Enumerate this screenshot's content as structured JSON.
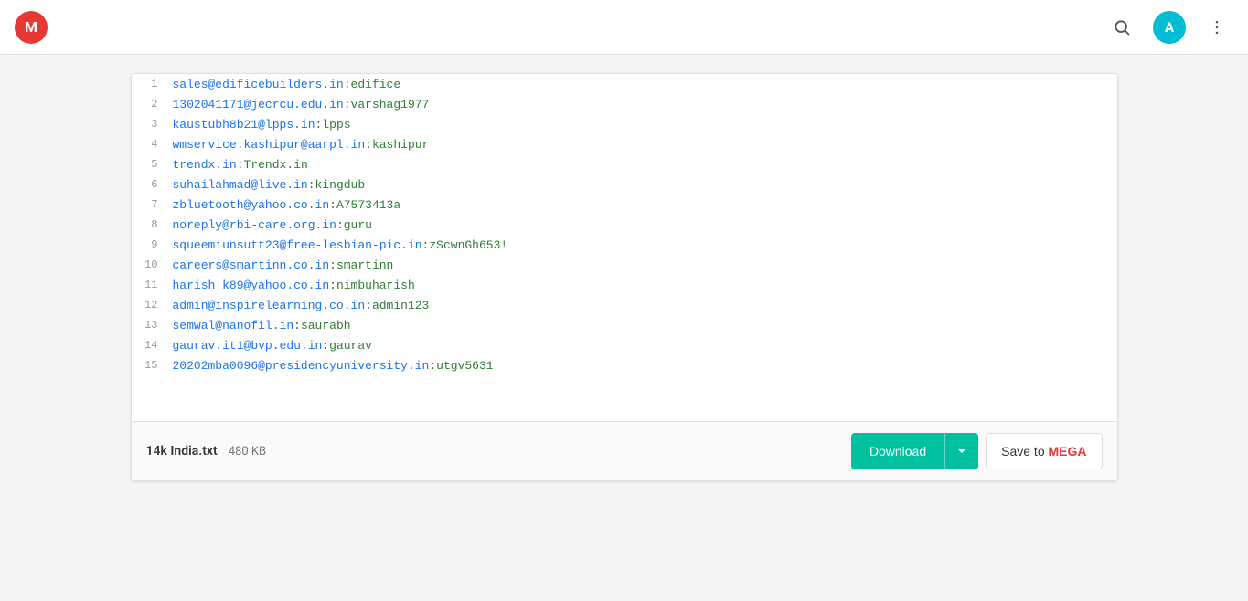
{
  "header": {
    "logo_letter": "M",
    "search_label": "search",
    "avatar_letter": "A",
    "more_label": "more options"
  },
  "file": {
    "name": "14k India.txt",
    "size": "480 KB",
    "download_label": "Download",
    "save_label": "Save to MEGA",
    "save_prefix": "Save to ",
    "save_brand": "MEGA"
  },
  "lines": [
    {
      "num": "1",
      "text": "sales@edificebuilders.in:edifice"
    },
    {
      "num": "2",
      "text": "1302041171@jecrcu.edu.in:varshag1977"
    },
    {
      "num": "3",
      "text": "kaustubh8b21@lpps.in:lpps"
    },
    {
      "num": "4",
      "text": "wmservice.kashipur@aarpl.in:kashipur"
    },
    {
      "num": "5",
      "text": "trendx.in:Trendx.in"
    },
    {
      "num": "6",
      "text": "suhailahmad@live.in:kingdub"
    },
    {
      "num": "7",
      "text": "zbluetooth@yahoo.co.in:A7573413a"
    },
    {
      "num": "8",
      "text": "noreply@rbi-care.org.in:guru"
    },
    {
      "num": "9",
      "text": "squeemiunsutt23@free-lesbian-pic.in:zScwnGh653!"
    },
    {
      "num": "10",
      "text": "careers@smartinn.co.in:smartinn"
    },
    {
      "num": "11",
      "text": "harish_k89@yahoo.co.in:nimbuharish"
    },
    {
      "num": "12",
      "text": "admin@inspirelearning.co.in:admin123"
    },
    {
      "num": "13",
      "text": "semwal@nanofil.in:saurabh"
    },
    {
      "num": "14",
      "text": "gaurav.it1@bvp.edu.in:gaurav"
    },
    {
      "num": "15",
      "text": "20202mba0096@presidencyuniversity.in:utgv5631"
    }
  ]
}
